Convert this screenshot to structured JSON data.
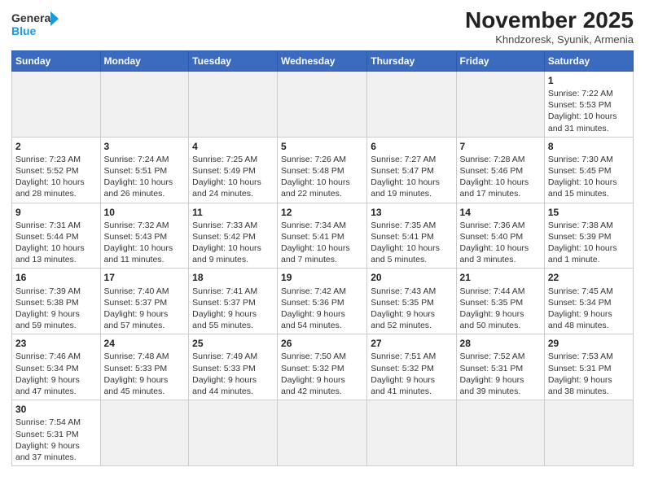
{
  "logo": {
    "text_general": "General",
    "text_blue": "Blue"
  },
  "title": "November 2025",
  "subtitle": "Khndzoresk, Syunik, Armenia",
  "days_of_week": [
    "Sunday",
    "Monday",
    "Tuesday",
    "Wednesday",
    "Thursday",
    "Friday",
    "Saturday"
  ],
  "weeks": [
    [
      {
        "day": "",
        "info": "",
        "empty": true
      },
      {
        "day": "",
        "info": "",
        "empty": true
      },
      {
        "day": "",
        "info": "",
        "empty": true
      },
      {
        "day": "",
        "info": "",
        "empty": true
      },
      {
        "day": "",
        "info": "",
        "empty": true
      },
      {
        "day": "",
        "info": "",
        "empty": true
      },
      {
        "day": "1",
        "info": "Sunrise: 7:22 AM\nSunset: 5:53 PM\nDaylight: 10 hours\nand 31 minutes."
      }
    ],
    [
      {
        "day": "2",
        "info": "Sunrise: 7:23 AM\nSunset: 5:52 PM\nDaylight: 10 hours\nand 28 minutes."
      },
      {
        "day": "3",
        "info": "Sunrise: 7:24 AM\nSunset: 5:51 PM\nDaylight: 10 hours\nand 26 minutes."
      },
      {
        "day": "4",
        "info": "Sunrise: 7:25 AM\nSunset: 5:49 PM\nDaylight: 10 hours\nand 24 minutes."
      },
      {
        "day": "5",
        "info": "Sunrise: 7:26 AM\nSunset: 5:48 PM\nDaylight: 10 hours\nand 22 minutes."
      },
      {
        "day": "6",
        "info": "Sunrise: 7:27 AM\nSunset: 5:47 PM\nDaylight: 10 hours\nand 19 minutes."
      },
      {
        "day": "7",
        "info": "Sunrise: 7:28 AM\nSunset: 5:46 PM\nDaylight: 10 hours\nand 17 minutes."
      },
      {
        "day": "8",
        "info": "Sunrise: 7:30 AM\nSunset: 5:45 PM\nDaylight: 10 hours\nand 15 minutes."
      }
    ],
    [
      {
        "day": "9",
        "info": "Sunrise: 7:31 AM\nSunset: 5:44 PM\nDaylight: 10 hours\nand 13 minutes."
      },
      {
        "day": "10",
        "info": "Sunrise: 7:32 AM\nSunset: 5:43 PM\nDaylight: 10 hours\nand 11 minutes."
      },
      {
        "day": "11",
        "info": "Sunrise: 7:33 AM\nSunset: 5:42 PM\nDaylight: 10 hours\nand 9 minutes."
      },
      {
        "day": "12",
        "info": "Sunrise: 7:34 AM\nSunset: 5:41 PM\nDaylight: 10 hours\nand 7 minutes."
      },
      {
        "day": "13",
        "info": "Sunrise: 7:35 AM\nSunset: 5:41 PM\nDaylight: 10 hours\nand 5 minutes."
      },
      {
        "day": "14",
        "info": "Sunrise: 7:36 AM\nSunset: 5:40 PM\nDaylight: 10 hours\nand 3 minutes."
      },
      {
        "day": "15",
        "info": "Sunrise: 7:38 AM\nSunset: 5:39 PM\nDaylight: 10 hours\nand 1 minute."
      }
    ],
    [
      {
        "day": "16",
        "info": "Sunrise: 7:39 AM\nSunset: 5:38 PM\nDaylight: 9 hours\nand 59 minutes."
      },
      {
        "day": "17",
        "info": "Sunrise: 7:40 AM\nSunset: 5:37 PM\nDaylight: 9 hours\nand 57 minutes."
      },
      {
        "day": "18",
        "info": "Sunrise: 7:41 AM\nSunset: 5:37 PM\nDaylight: 9 hours\nand 55 minutes."
      },
      {
        "day": "19",
        "info": "Sunrise: 7:42 AM\nSunset: 5:36 PM\nDaylight: 9 hours\nand 54 minutes."
      },
      {
        "day": "20",
        "info": "Sunrise: 7:43 AM\nSunset: 5:35 PM\nDaylight: 9 hours\nand 52 minutes."
      },
      {
        "day": "21",
        "info": "Sunrise: 7:44 AM\nSunset: 5:35 PM\nDaylight: 9 hours\nand 50 minutes."
      },
      {
        "day": "22",
        "info": "Sunrise: 7:45 AM\nSunset: 5:34 PM\nDaylight: 9 hours\nand 48 minutes."
      }
    ],
    [
      {
        "day": "23",
        "info": "Sunrise: 7:46 AM\nSunset: 5:34 PM\nDaylight: 9 hours\nand 47 minutes."
      },
      {
        "day": "24",
        "info": "Sunrise: 7:48 AM\nSunset: 5:33 PM\nDaylight: 9 hours\nand 45 minutes."
      },
      {
        "day": "25",
        "info": "Sunrise: 7:49 AM\nSunset: 5:33 PM\nDaylight: 9 hours\nand 44 minutes."
      },
      {
        "day": "26",
        "info": "Sunrise: 7:50 AM\nSunset: 5:32 PM\nDaylight: 9 hours\nand 42 minutes."
      },
      {
        "day": "27",
        "info": "Sunrise: 7:51 AM\nSunset: 5:32 PM\nDaylight: 9 hours\nand 41 minutes."
      },
      {
        "day": "28",
        "info": "Sunrise: 7:52 AM\nSunset: 5:31 PM\nDaylight: 9 hours\nand 39 minutes."
      },
      {
        "day": "29",
        "info": "Sunrise: 7:53 AM\nSunset: 5:31 PM\nDaylight: 9 hours\nand 38 minutes."
      }
    ],
    [
      {
        "day": "30",
        "info": "Sunrise: 7:54 AM\nSunset: 5:31 PM\nDaylight: 9 hours\nand 37 minutes."
      },
      {
        "day": "",
        "info": "",
        "empty": true
      },
      {
        "day": "",
        "info": "",
        "empty": true
      },
      {
        "day": "",
        "info": "",
        "empty": true
      },
      {
        "day": "",
        "info": "",
        "empty": true
      },
      {
        "day": "",
        "info": "",
        "empty": true
      },
      {
        "day": "",
        "info": "",
        "empty": true
      }
    ]
  ]
}
